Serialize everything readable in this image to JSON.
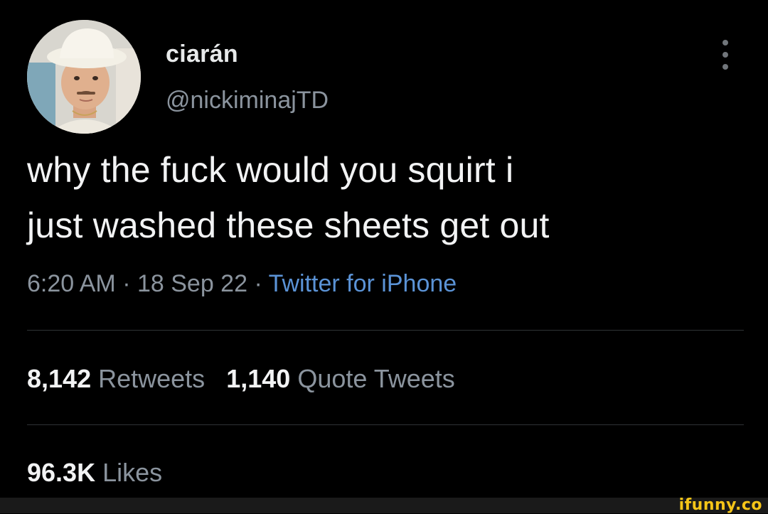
{
  "tweet": {
    "display_name": "ciarán",
    "handle": "@nickiminajTD",
    "text_line1": "why the fuck would you squirt i",
    "text_line2": "just washed these sheets get out",
    "time": "6:20 AM",
    "date": "18 Sep 22",
    "separator": " · ",
    "source": "Twitter for iPhone",
    "retweets_count": "8,142",
    "retweets_label": "Retweets",
    "quotes_count": "1,140",
    "quotes_label": "Quote Tweets",
    "likes_count": "96.3K",
    "likes_label": "Likes"
  },
  "watermark": "ifunny.co",
  "colors": {
    "background": "#000000",
    "text": "#e7e9ea",
    "secondary": "#8b949e",
    "link": "#5b93d6",
    "divider": "#2f3336",
    "watermark": "#f5c518"
  },
  "icons": {
    "more": "more-vertical-icon"
  }
}
